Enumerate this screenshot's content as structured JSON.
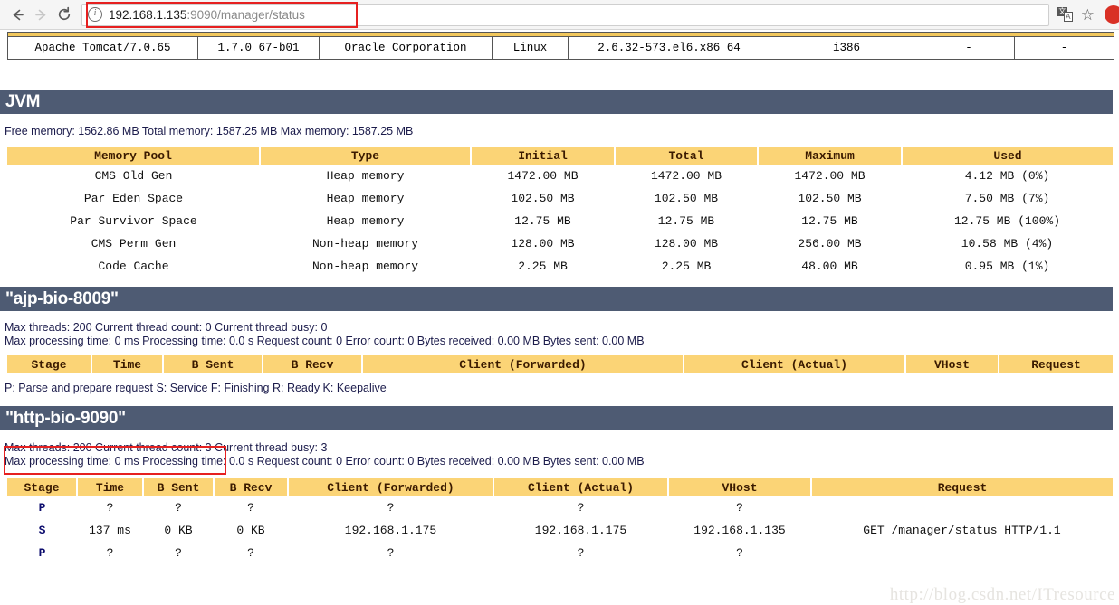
{
  "browser": {
    "back_label": "←",
    "forward_label": "→",
    "reload_label": "⟳",
    "url_host": "192.168.1.135",
    "url_rest": ":9090/manager/status",
    "info_icon_label": "i",
    "translate_icon_a": "文",
    "translate_icon_b": "A",
    "star_label": "☆"
  },
  "server_info": {
    "row": [
      "Apache Tomcat/7.0.65",
      "1.7.0_67-b01",
      "Oracle Corporation",
      "Linux",
      "2.6.32-573.el6.x86_64",
      "i386",
      "-",
      "-"
    ]
  },
  "jvm": {
    "title": "JVM",
    "summary": "Free memory: 1562.86 MB Total memory: 1587.25 MB Max memory: 1587.25 MB",
    "columns": [
      "Memory Pool",
      "Type",
      "Initial",
      "Total",
      "Maximum",
      "Used"
    ],
    "rows": [
      [
        "CMS Old Gen",
        "Heap memory",
        "1472.00 MB",
        "1472.00 MB",
        "1472.00 MB",
        "4.12 MB (0%)"
      ],
      [
        "Par Eden Space",
        "Heap memory",
        "102.50 MB",
        "102.50 MB",
        "102.50 MB",
        "7.50 MB (7%)"
      ],
      [
        "Par Survivor Space",
        "Heap memory",
        "12.75 MB",
        "12.75 MB",
        "12.75 MB",
        "12.75 MB (100%)"
      ],
      [
        "CMS Perm Gen",
        "Non-heap memory",
        "128.00 MB",
        "128.00 MB",
        "256.00 MB",
        "10.58 MB (4%)"
      ],
      [
        "Code Cache",
        "Non-heap memory",
        "2.25 MB",
        "2.25 MB",
        "48.00 MB",
        "0.95 MB (1%)"
      ]
    ]
  },
  "ajp_connector": {
    "title": "\"ajp-bio-8009\"",
    "threads_line": "Max threads: 200 Current thread count: 0 Current thread busy: 0",
    "processing_line": "Max processing time: 0 ms Processing time: 0.0 s Request count: 0 Error count: 0 Bytes received: 0.00 MB Bytes sent: 0.00 MB",
    "columns": [
      "Stage",
      "Time",
      "B Sent",
      "B Recv",
      "Client (Forwarded)",
      "Client (Actual)",
      "VHost",
      "Request"
    ],
    "rows": [],
    "legend": "P: Parse and prepare request S: Service F: Finishing R: Ready K: Keepalive"
  },
  "http_connector": {
    "title": "\"http-bio-9090\"",
    "threads_line": "Max threads: 200 Current thread count: 3 Current thread busy: 3",
    "processing_line": "Max processing time: 0 ms Processing time: 0.0 s Request count: 0 Error count: 0 Bytes received: 0.00 MB Bytes sent: 0.00 MB",
    "columns": [
      "Stage",
      "Time",
      "B Sent",
      "B Recv",
      "Client (Forwarded)",
      "Client (Actual)",
      "VHost",
      "Request"
    ],
    "rows": [
      [
        "P",
        "?",
        "?",
        "?",
        "?",
        "?",
        "?",
        ""
      ],
      [
        "S",
        "137 ms",
        "0 KB",
        "0 KB",
        "192.168.1.175",
        "192.168.1.175",
        "192.168.1.135",
        "GET /manager/status HTTP/1.1"
      ],
      [
        "P",
        "?",
        "?",
        "?",
        "?",
        "?",
        "?",
        ""
      ]
    ]
  },
  "watermark": {
    "text": "http://blog.csdn.net/ITresource"
  },
  "colors": {
    "section_bar": "#4e5b73",
    "table_header": "#fbd476",
    "annotation": "#e62020",
    "profile": "#d93025"
  }
}
